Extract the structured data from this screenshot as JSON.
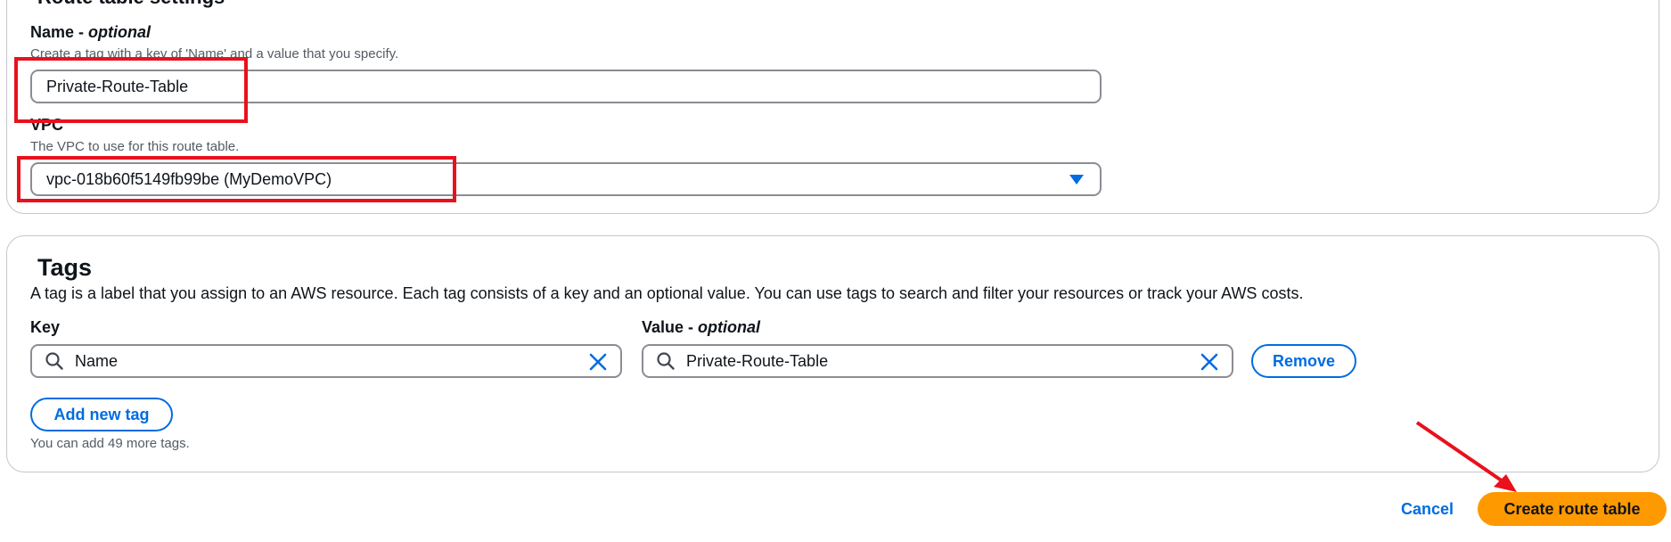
{
  "route_table_settings": {
    "title": "Route table settings",
    "name_label": "Name - ",
    "name_optional": "optional",
    "name_description": "Create a tag with a key of 'Name' and a value that you specify.",
    "name_value": "Private-Route-Table",
    "vpc_label": "VPC",
    "vpc_description": "The VPC to use for this route table.",
    "vpc_value": "vpc-018b60f5149fb99be (MyDemoVPC)"
  },
  "tags": {
    "title": "Tags",
    "description": "A tag is a label that you assign to an AWS resource. Each tag consists of a key and an optional value. You can use tags to search and filter your resources or track your AWS costs.",
    "key_label": "Key",
    "value_label": "Value - ",
    "value_optional": "optional",
    "rows": [
      {
        "key": "Name",
        "value": "Private-Route-Table"
      }
    ],
    "remove_label": "Remove",
    "add_label": "Add new tag",
    "remaining_hint": "You can add 49 more tags."
  },
  "footer": {
    "cancel_label": "Cancel",
    "create_label": "Create route table"
  },
  "colors": {
    "accent": "#006ce0",
    "primary_button": "#ff9900",
    "annotation": "#e8111c"
  }
}
